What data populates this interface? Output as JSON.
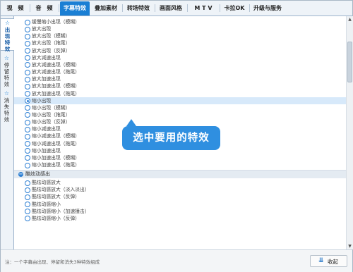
{
  "top_tabs": [
    {
      "label": "视　频",
      "active": false
    },
    {
      "label": "音　频",
      "active": false
    },
    {
      "label": "字幕特效",
      "active": true
    },
    {
      "label": "叠加素材",
      "active": false
    },
    {
      "label": "转场特效",
      "active": false
    },
    {
      "label": "画面风格",
      "active": false
    },
    {
      "label": "M T V",
      "active": false
    },
    {
      "label": "卡拉OK",
      "active": false
    },
    {
      "label": "升级与服务",
      "active": false
    }
  ],
  "side_tabs": [
    {
      "label": "出现特效",
      "active": true,
      "icon": "star-icon"
    },
    {
      "label": "停留特效",
      "active": false,
      "icon": "star-icon"
    },
    {
      "label": "消失特效",
      "active": false,
      "icon": "star-icon"
    }
  ],
  "list_items_group1": [
    {
      "label": "缓慢缩小出现（模糊）",
      "selected": false
    },
    {
      "label": "放大出现",
      "selected": false
    },
    {
      "label": "放大出现（模糊）",
      "selected": false
    },
    {
      "label": "放大出现（拖尾）",
      "selected": false
    },
    {
      "label": "放大出现（反弹）",
      "selected": false
    },
    {
      "label": "放大减速出现",
      "selected": false
    },
    {
      "label": "放大减速出现（模糊）",
      "selected": false
    },
    {
      "label": "放大减速出现（拖尾）",
      "selected": false
    },
    {
      "label": "放大加速出现",
      "selected": false
    },
    {
      "label": "放大加速出现（模糊）",
      "selected": false
    },
    {
      "label": "放大加速出现（拖尾）",
      "selected": false
    },
    {
      "label": "缩小出现",
      "selected": true
    },
    {
      "label": "缩小出现（模糊）",
      "selected": false
    },
    {
      "label": "缩小出现（拖尾）",
      "selected": false
    },
    {
      "label": "缩小出现（反弹）",
      "selected": false
    },
    {
      "label": "缩小减速出现",
      "selected": false
    },
    {
      "label": "缩小减速出现（模糊）",
      "selected": false
    },
    {
      "label": "缩小减速出现（拖尾）",
      "selected": false
    },
    {
      "label": "缩小加速出现",
      "selected": false
    },
    {
      "label": "缩小加速出现（模糊）",
      "selected": false
    },
    {
      "label": "缩小加速出现（拖尾）",
      "selected": false
    }
  ],
  "group2": {
    "title": "酷炫动感出",
    "items": [
      {
        "label": "酷炫动感放大",
        "selected": false
      },
      {
        "label": "酷炫动感放大（淡入淡出）",
        "selected": false
      },
      {
        "label": "酷炫动感放大（反弹）",
        "selected": false
      },
      {
        "label": "酷炫动感缩小",
        "selected": false
      },
      {
        "label": "酷炫动感缩小（加速撞击）",
        "selected": false
      },
      {
        "label": "酷炫动感缩小（反弹）",
        "selected": false
      }
    ]
  },
  "callout": {
    "text": "选中要用的特效"
  },
  "footer": {
    "note": "注：一个字幕由出现、停留和消失3种特效组成",
    "collapse_label": "收起"
  },
  "colors": {
    "accent": "#1a7fd4",
    "selection": "#d7e9fa",
    "callout": "#2f8fe0"
  }
}
